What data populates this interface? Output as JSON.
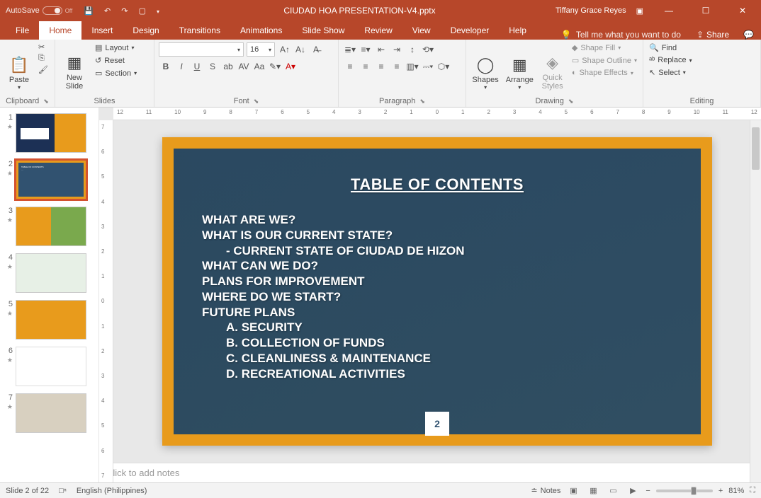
{
  "titlebar": {
    "autosave_label": "AutoSave",
    "autosave_state": "Off",
    "filename": "CIUDAD HOA PRESENTATION-V4.pptx",
    "user": "Tiffany Grace Reyes"
  },
  "menu": {
    "file": "File",
    "home": "Home",
    "insert": "Insert",
    "design": "Design",
    "transitions": "Transitions",
    "animations": "Animations",
    "slideshow": "Slide Show",
    "review": "Review",
    "view": "View",
    "developer": "Developer",
    "help": "Help",
    "tellme": "Tell me what you want to do",
    "share": "Share"
  },
  "ribbon": {
    "clipboard": {
      "label": "Clipboard",
      "paste": "Paste"
    },
    "slides": {
      "label": "Slides",
      "new_slide": "New\nSlide",
      "layout": "Layout",
      "reset": "Reset",
      "section": "Section"
    },
    "font": {
      "label": "Font",
      "size": "16"
    },
    "paragraph": {
      "label": "Paragraph"
    },
    "drawing": {
      "label": "Drawing",
      "shapes": "Shapes",
      "arrange": "Arrange",
      "quick_styles": "Quick\nStyles",
      "shape_fill": "Shape Fill",
      "shape_outline": "Shape Outline",
      "shape_effects": "Shape Effects"
    },
    "editing": {
      "label": "Editing",
      "find": "Find",
      "replace": "Replace",
      "select": "Select"
    }
  },
  "ruler_h": [
    "12",
    "11",
    "10",
    "9",
    "8",
    "7",
    "6",
    "5",
    "4",
    "3",
    "2",
    "1",
    "0",
    "1",
    "2",
    "3",
    "4",
    "5",
    "6",
    "7",
    "8",
    "9",
    "10",
    "11",
    "12"
  ],
  "ruler_v": [
    "7",
    "6",
    "5",
    "4",
    "3",
    "2",
    "1",
    "0",
    "1",
    "2",
    "3",
    "4",
    "5",
    "6",
    "7"
  ],
  "thumbnails": [
    {
      "n": "1"
    },
    {
      "n": "2"
    },
    {
      "n": "3"
    },
    {
      "n": "4"
    },
    {
      "n": "5"
    },
    {
      "n": "6"
    },
    {
      "n": "7"
    }
  ],
  "slide": {
    "title": "TABLE OF CONTENTS",
    "lines": [
      "WHAT ARE WE?",
      "WHAT IS OUR CURRENT STATE?",
      "        - CURRENT STATE OF CIUDAD DE HIZON",
      "WHAT CAN WE DO?",
      "PLANS FOR IMPROVEMENT",
      "WHERE DO WE START?",
      "FUTURE PLANS",
      "        A. SECURITY",
      "        B. COLLECTION OF FUNDS",
      "        C. CLEANLINESS & MAINTENANCE",
      "        D. RECREATIONAL ACTIVITIES"
    ],
    "page": "2"
  },
  "notes": {
    "placeholder": "Click to add notes"
  },
  "status": {
    "slide_of": "Slide 2 of 22",
    "language": "English (Philippines)",
    "notes_btn": "Notes",
    "zoom": "81%"
  }
}
